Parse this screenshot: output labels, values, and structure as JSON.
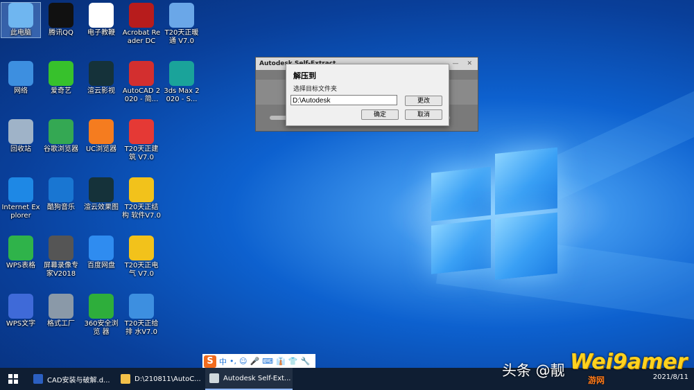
{
  "desktop_icons": [
    {
      "label": "此电脑",
      "icon": "computer-icon",
      "color": "#6fb6f0"
    },
    {
      "label": "腾讯QQ",
      "icon": "qq-penguin-icon",
      "color": "#111111"
    },
    {
      "label": "电子教鞭",
      "icon": "teacher-pointer-icon",
      "color": "#ffffff"
    },
    {
      "label": "Acrobat Reader DC",
      "icon": "acrobat-icon",
      "color": "#b71c1c"
    },
    {
      "label": "T20天正暖通 V7.0",
      "icon": "tangent-hvac-icon",
      "color": "#6aa7e8"
    },
    {
      "label": "网络",
      "icon": "network-icon",
      "color": "#3d8fe0"
    },
    {
      "label": "爱奇艺",
      "icon": "iqiyi-icon",
      "color": "#37c12c"
    },
    {
      "label": "渲云影视",
      "icon": "xuanyun-icon",
      "color": "#15323a"
    },
    {
      "label": "AutoCAD 2020 - 简...",
      "icon": "autocad-icon",
      "color": "#d32f2f"
    },
    {
      "label": "3ds Max 2020 - S...",
      "icon": "3dsmax-icon",
      "color": "#1aa39a"
    },
    {
      "label": "回收站",
      "icon": "recycle-bin-icon",
      "color": "#9fb3c8"
    },
    {
      "label": "谷歌浏览器",
      "icon": "chrome-icon",
      "color": "#34a853"
    },
    {
      "label": "UC浏览器",
      "icon": "uc-browser-icon",
      "color": "#f57c1f"
    },
    {
      "label": "T20天正建筑 V7.0",
      "icon": "tangent-arch-icon",
      "color": "#e53935"
    },
    {
      "label": "Internet Explorer",
      "icon": "ie-icon",
      "color": "#1e88e5"
    },
    {
      "label": "酷狗音乐",
      "icon": "kugou-icon",
      "color": "#1976d2"
    },
    {
      "label": "渲云效果图",
      "icon": "xuanyun-render-icon",
      "color": "#15323a"
    },
    {
      "label": "T20天正结构 软件V7.0",
      "icon": "tangent-struct-icon",
      "color": "#f2c21b"
    },
    {
      "label": "WPS表格",
      "icon": "wps-sheet-icon",
      "color": "#2fb34a"
    },
    {
      "label": "屏幕录像专 家V2018",
      "icon": "screen-recorder-icon",
      "color": "#555555"
    },
    {
      "label": "百度网盘",
      "icon": "baidu-pan-icon",
      "color": "#2f8cf0"
    },
    {
      "label": "T20天正电气 V7.0",
      "icon": "tangent-elec-icon",
      "color": "#f2c21b"
    },
    {
      "label": "WPS文字",
      "icon": "wps-doc-icon",
      "color": "#3f6ad8"
    },
    {
      "label": "格式工厂",
      "icon": "format-factory-icon",
      "color": "#8a99a8"
    },
    {
      "label": "360安全浏览 器",
      "icon": "360-browser-icon",
      "color": "#2eae3b"
    },
    {
      "label": "T20天正给排 水V7.0",
      "icon": "tangent-water-icon",
      "color": "#3d8fe0"
    }
  ],
  "back_dialog": {
    "title": "Autodesk Self-Extract",
    "controls": [
      "—",
      "✕"
    ]
  },
  "dialog": {
    "title": "解压到",
    "subtitle": "选择目标文件夹",
    "path_value": "D:\\Autodesk",
    "change_label": "更改",
    "ok_label": "确定",
    "cancel_label": "取消"
  },
  "ime": {
    "logo": "S",
    "mode": "中",
    "items": [
      "•,",
      "☺",
      "🎤",
      "⌨",
      "👔",
      "👕",
      "🔧"
    ]
  },
  "taskbar": {
    "start_icon": "windows-start-icon",
    "tasks": [
      {
        "label": "CAD安装与破解.d...",
        "icon": "word-doc-icon",
        "color": "#2b5fc1"
      },
      {
        "label": "D:\\210811\\AutoC...",
        "icon": "folder-icon",
        "color": "#f2c04a"
      },
      {
        "label": "Autodesk Self-Ext...",
        "icon": "installer-icon",
        "color": "#cfd8dc"
      }
    ],
    "date": "2021/8/11"
  },
  "watermark": {
    "toutiao": "头条 @靓",
    "brand": "Wei9amer",
    "sub": "游网"
  }
}
